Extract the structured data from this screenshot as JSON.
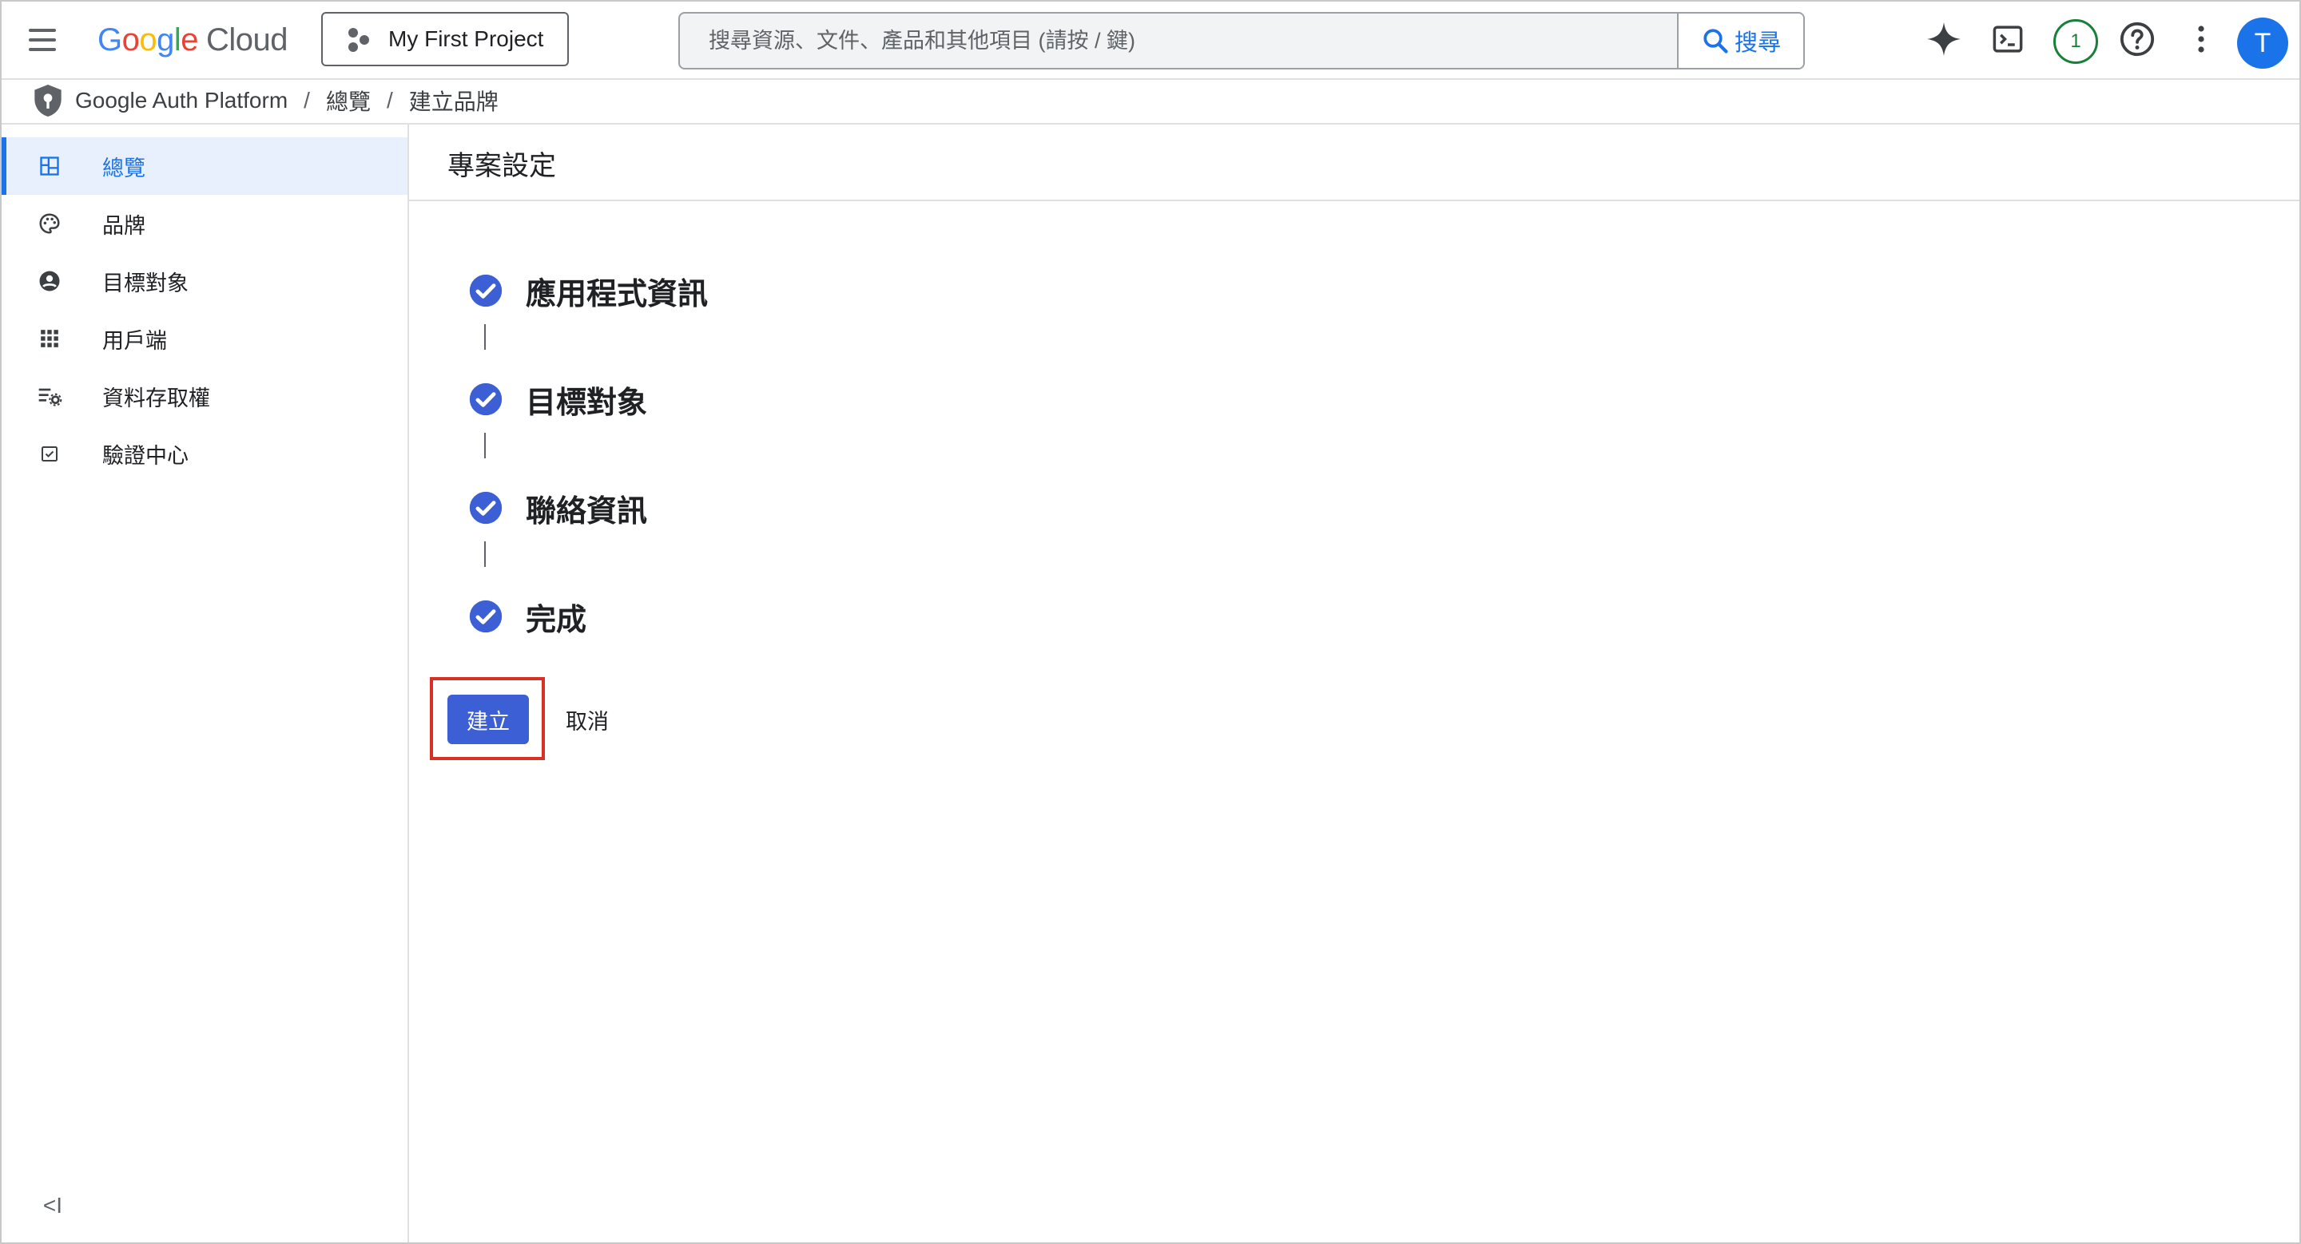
{
  "app": {
    "logo_google": "Google",
    "logo_cloud": "Cloud",
    "project_label": "My First Project",
    "search_placeholder": "搜尋資源、文件、產品和其他項目 (請按 / 鍵)",
    "search_button": "搜尋",
    "notification_count": "1",
    "avatar_initial": "T"
  },
  "breadcrumb": {
    "product": "Google Auth Platform",
    "sep": "/",
    "overview": "總覽",
    "current": "建立品牌"
  },
  "sidebar": {
    "items": [
      {
        "label": "總覽",
        "icon": "dashboard-icon",
        "active": true
      },
      {
        "label": "品牌",
        "icon": "palette-icon",
        "active": false
      },
      {
        "label": "目標對象",
        "icon": "account-circle-icon",
        "active": false
      },
      {
        "label": "用戶端",
        "icon": "apps-grid-icon",
        "active": false
      },
      {
        "label": "資料存取權",
        "icon": "data-access-settings-icon",
        "active": false
      },
      {
        "label": "驗證中心",
        "icon": "verification-checkbox-icon",
        "active": false
      }
    ],
    "collapse_label": "<I"
  },
  "main": {
    "title": "專案設定",
    "steps": [
      {
        "label": "應用程式資訊",
        "status": "complete"
      },
      {
        "label": "目標對象",
        "status": "complete"
      },
      {
        "label": "聯絡資訊",
        "status": "complete"
      },
      {
        "label": "完成",
        "status": "complete"
      }
    ],
    "create_button": "建立",
    "cancel_button": "取消"
  },
  "colors": {
    "accent": "#1a73e8",
    "step_check": "#3c5fd6",
    "highlight_border": "#d93025",
    "notification_green": "#188038"
  }
}
